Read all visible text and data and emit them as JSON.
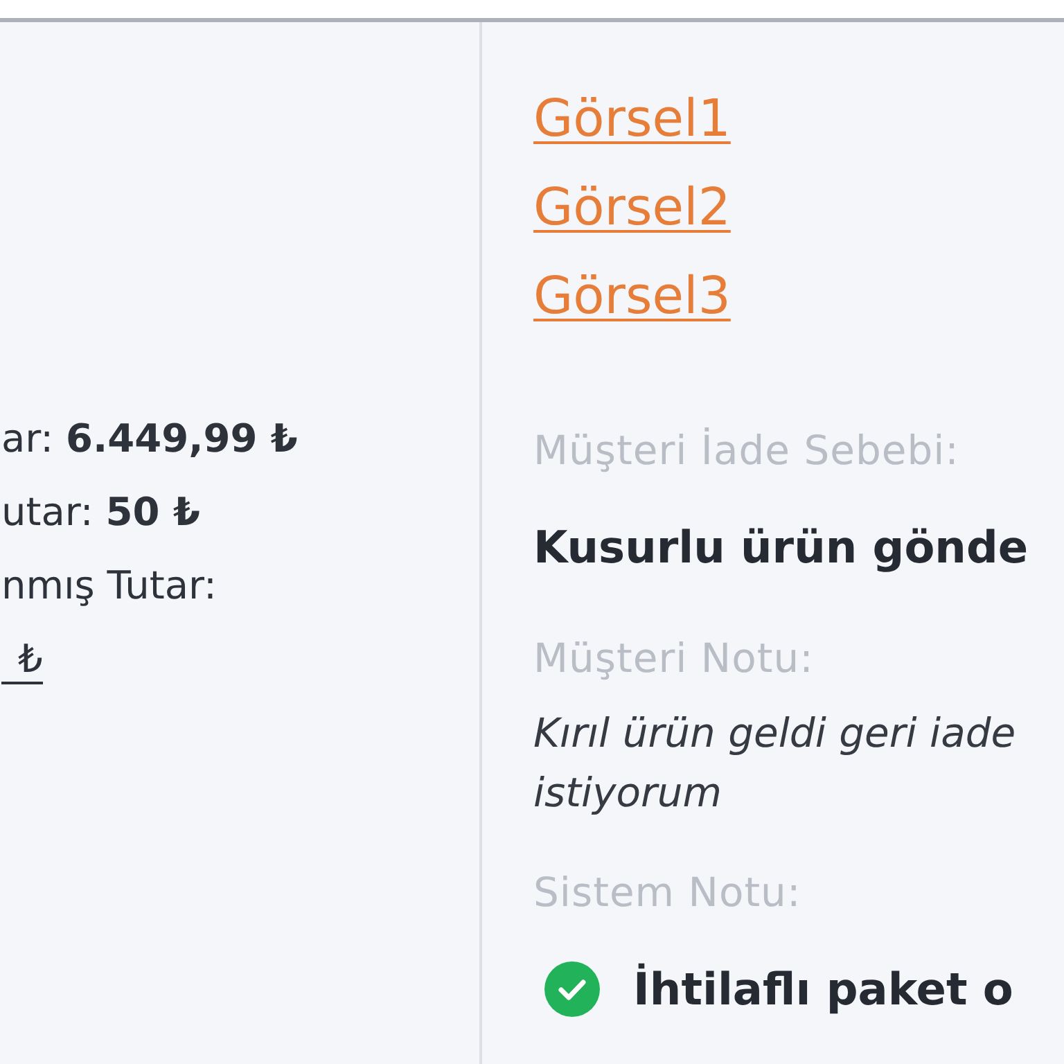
{
  "amounts_panel": {
    "lines": [
      {
        "kind": "text",
        "text": "ar: **6.449,99 ₺**"
      },
      {
        "kind": "text",
        "text": "utar: **50 ₺**"
      },
      {
        "kind": "text",
        "text": "nmış Tutar:"
      },
      {
        "kind": "link",
        "text": "₺"
      }
    ]
  },
  "details_panel": {
    "image_links": [
      "Görsel1",
      "Görsel2",
      "Görsel3"
    ],
    "return_reason": {
      "label": "Müşteri İade Sebebi:",
      "value": "Kusurlu ürün gönde"
    },
    "customer_note": {
      "label": "Müşteri Notu:",
      "value": "Kırıl ürün geldi geri iade\nistiyorum"
    },
    "system_note": {
      "label": "Sistem Notu:",
      "value": "İhtilaflı paket o",
      "checked": true
    }
  }
}
